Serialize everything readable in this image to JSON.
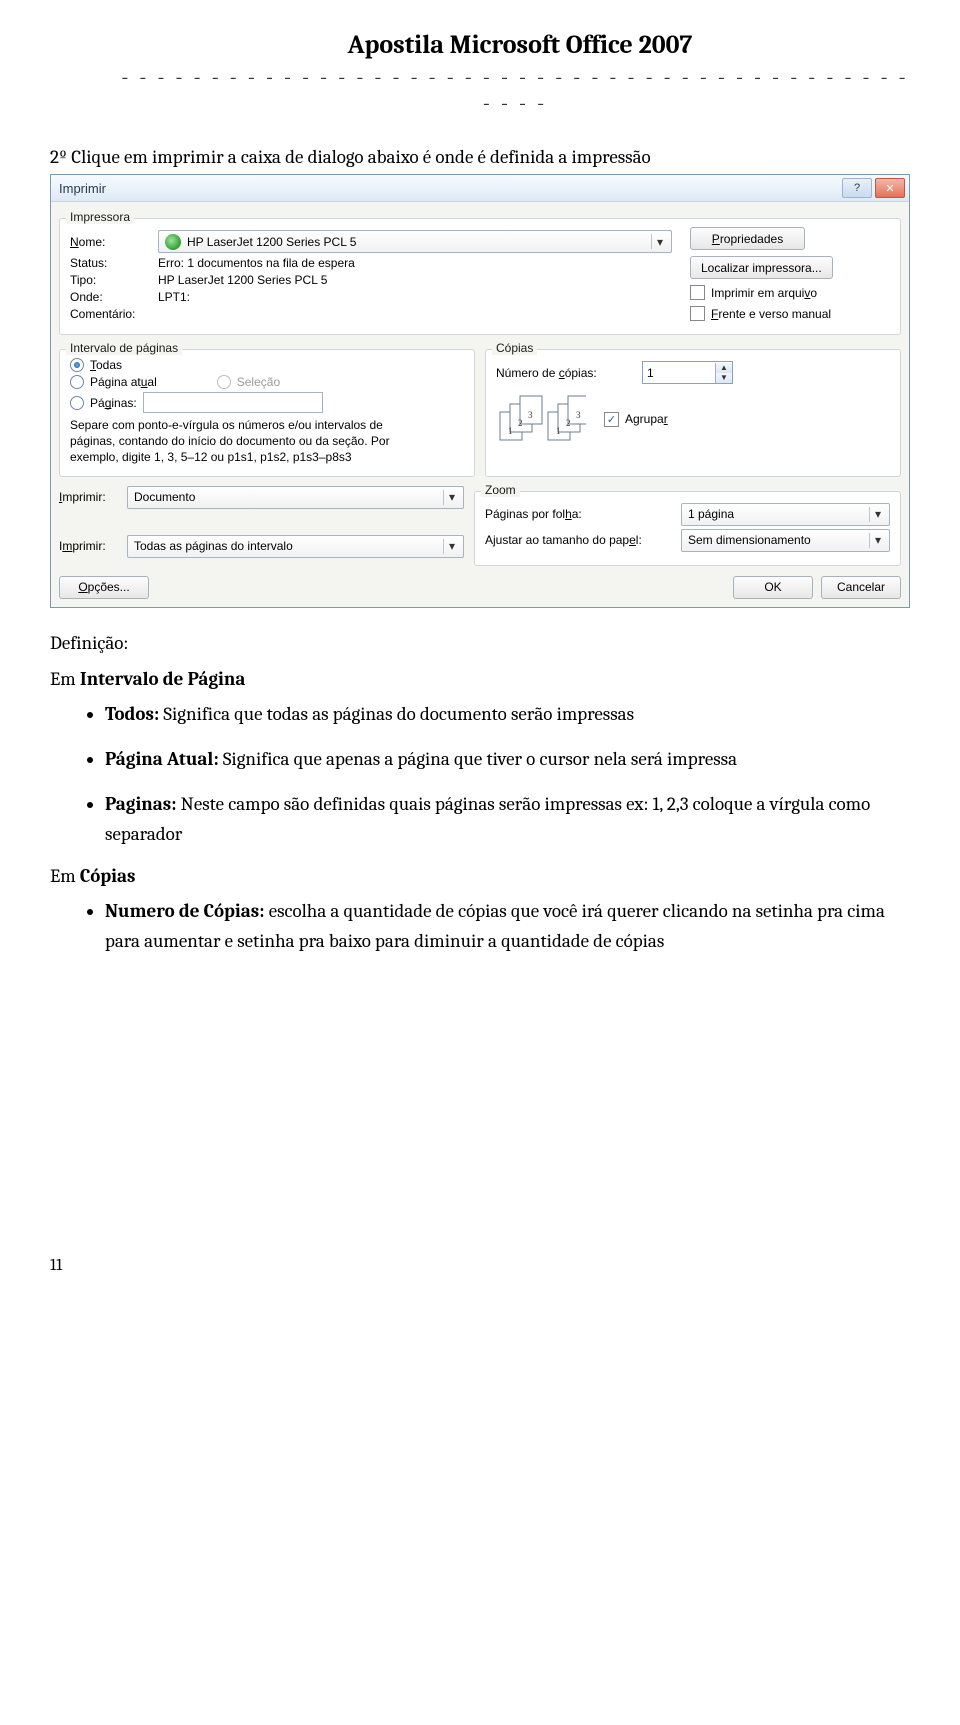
{
  "doc": {
    "title": "Apostila Microsoft Office 2007",
    "dashes": "- - - - - - - - - - - - - - - - - - - - - - - - - - - - - - - - - - - - - - - - - - - - - - - -",
    "intro": "2º Clique em imprimir a caixa de dialogo abaixo é onde é definida a impressão",
    "definicao": "Definição:",
    "sec_intervalo": "Em Intervalo de Página",
    "bullet_todos_b": "Todos:",
    "bullet_todos_t": " Significa que todas as páginas do documento serão impressas",
    "bullet_atual_b": "Página Atual:",
    "bullet_atual_t": " Significa que apenas a página que tiver o cursor nela será impressa",
    "bullet_pag_b": "Paginas:",
    "bullet_pag_t": " Neste campo são definidas quais páginas serão impressas ex: 1, 2,3 coloque a vírgula como separador",
    "sec_copias": "Em Cópias",
    "bullet_num_b": "Numero de Cópias:",
    "bullet_num_t": " escolha a quantidade de cópias que você irá querer clicando na setinha pra cima para aumentar e setinha pra baixo para diminuir a quantidade de cópias",
    "pagenum": "11"
  },
  "dlg": {
    "title": "Imprimir",
    "grp_printer": "Impressora",
    "lbl_nome": "Nome:",
    "printer_name": "HP LaserJet 1200 Series PCL 5",
    "btn_props": "Propriedades",
    "lbl_status": "Status:",
    "status_val": "Erro: 1 documentos na fila de espera",
    "btn_find": "Localizar impressora...",
    "lbl_tipo": "Tipo:",
    "tipo_val": "HP LaserJet 1200 Series PCL 5",
    "chk_file": "Imprimir em arquivo",
    "lbl_onde": "Onde:",
    "onde_val": "LPT1:",
    "chk_duplex": "Frente e verso manual",
    "lbl_coment": "Comentário:",
    "grp_range": "Intervalo de páginas",
    "rb_todas": "Todas",
    "rb_atual": "Página atual",
    "rb_selecao": "Seleção",
    "rb_paginas": "Páginas:",
    "range_note": "Separe com ponto-e-vírgula os números e/ou intervalos de páginas, contando do início do documento ou da seção. Por exemplo, digite 1, 3, 5–12 ou p1s1, p1s2, p1s3–p8s3",
    "grp_copias": "Cópias",
    "lbl_numcop": "Número de cópias:",
    "numcop_val": "1",
    "chk_agrupar": "Agrupar",
    "lbl_imprimir": "Imprimir:",
    "dd_doc": "Documento",
    "dd_todas": "Todas as páginas do intervalo",
    "grp_zoom": "Zoom",
    "lbl_ppf": "Páginas por folha:",
    "dd_ppf": "1 página",
    "lbl_ajustar": "Ajustar ao tamanho do papel:",
    "dd_ajustar": "Sem dimensionamento",
    "btn_opcoes": "Opções...",
    "btn_ok": "OK",
    "btn_cancel": "Cancelar"
  }
}
